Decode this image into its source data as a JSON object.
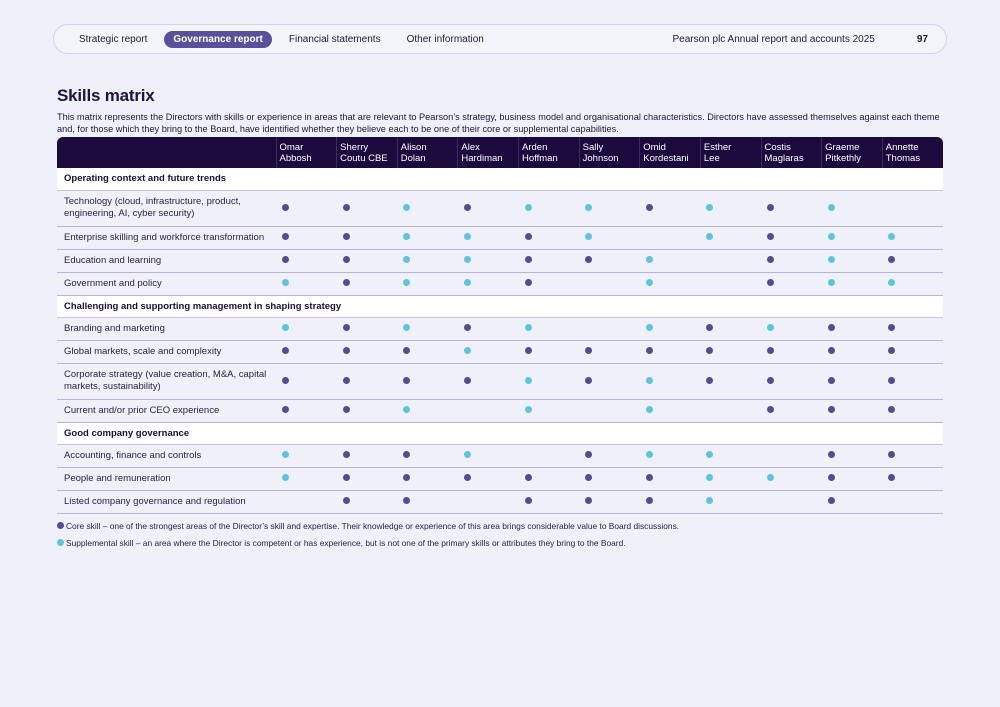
{
  "nav": {
    "links": [
      {
        "label": "Strategic report",
        "active": false
      },
      {
        "label": "Governance report",
        "active": true
      },
      {
        "label": "Financial statements",
        "active": false
      },
      {
        "label": "Other information",
        "active": false
      }
    ],
    "report_title": "Pearson plc Annual report and accounts 2025",
    "page_number": "97"
  },
  "page": {
    "title": "Skills matrix",
    "intro": "This matrix represents the Directors with skills or experience in areas that are relevant to Pearson’s strategy, business model and organisational characteristics. Directors have assessed themselves against each theme and, for those which they bring to the Board, have identified whether they believe each to be one of their core or supplemental capabilities."
  },
  "colors": {
    "core": "#554a93",
    "supplemental": "#5cc4db",
    "header_bg": "#1c0a3e",
    "active_nav": "#5a4f9a"
  },
  "directors": [
    [
      "Omar",
      "Abbosh"
    ],
    [
      "Sherry",
      "Coutu CBE"
    ],
    [
      "Alison",
      "Dolan"
    ],
    [
      "Alex",
      "Hardiman"
    ],
    [
      "Arden",
      "Hoffman"
    ],
    [
      "Sally",
      "Johnson"
    ],
    [
      "Omid",
      "Kordestani"
    ],
    [
      "Esther",
      "Lee"
    ],
    [
      "Costis",
      "Maglaras"
    ],
    [
      "Graeme",
      "Pitkethly"
    ],
    [
      "Annette",
      "Thomas"
    ]
  ],
  "sections": [
    {
      "title": "Operating context and future trends",
      "rows": [
        {
          "label": "Technology (cloud, infrastructure, product, engineering, AI, cyber security)",
          "cells": [
            "c",
            "c",
            "s",
            "c",
            "s",
            "s",
            "c",
            "s",
            "c",
            "s",
            ""
          ]
        },
        {
          "label": "Enterprise skilling and workforce transformation",
          "cells": [
            "c",
            "c",
            "s",
            "s",
            "c",
            "s",
            "",
            "s",
            "c",
            "s",
            "s"
          ]
        },
        {
          "label": "Education and learning",
          "cells": [
            "c",
            "c",
            "s",
            "s",
            "c",
            "c",
            "s",
            "",
            "c",
            "s",
            "c"
          ]
        },
        {
          "label": "Government and policy",
          "cells": [
            "s",
            "c",
            "s",
            "s",
            "c",
            "",
            "s",
            "",
            "c",
            "s",
            "s"
          ]
        }
      ]
    },
    {
      "title": "Challenging and supporting management in shaping strategy",
      "rows": [
        {
          "label": "Branding and marketing",
          "cells": [
            "s",
            "c",
            "s",
            "c",
            "s",
            "",
            "s",
            "c",
            "s",
            "c",
            "c"
          ]
        },
        {
          "label": "Global markets, scale and complexity",
          "cells": [
            "c",
            "c",
            "c",
            "s",
            "c",
            "c",
            "c",
            "c",
            "c",
            "c",
            "c"
          ]
        },
        {
          "label": "Corporate strategy (value creation, M&A, capital markets, sustainability)",
          "cells": [
            "c",
            "c",
            "c",
            "c",
            "s",
            "c",
            "s",
            "c",
            "c",
            "c",
            "c"
          ]
        },
        {
          "label": "Current and/or prior CEO experience",
          "cells": [
            "c",
            "c",
            "s",
            "",
            "s",
            "",
            "s",
            "",
            "c",
            "c",
            "c"
          ]
        }
      ]
    },
    {
      "title": "Good company governance",
      "rows": [
        {
          "label": "Accounting, finance and controls",
          "cells": [
            "s",
            "c",
            "c",
            "s",
            "",
            "c",
            "s",
            "s",
            "",
            "c",
            "c"
          ]
        },
        {
          "label": "People and remuneration",
          "cells": [
            "s",
            "c",
            "c",
            "c",
            "c",
            "c",
            "c",
            "s",
            "s",
            "c",
            "c"
          ]
        },
        {
          "label": "Listed company governance and regulation",
          "cells": [
            "",
            "c",
            "c",
            "",
            "c",
            "c",
            "c",
            "s",
            "",
            "c",
            ""
          ]
        }
      ]
    }
  ],
  "legend": {
    "core": "Core skill – one of the strongest areas of the Director’s skill and expertise. Their knowledge or experience of this area brings considerable value to Board discussions.",
    "supplemental": "Supplemental skill – an area where the Director is competent or has experience, but is not one of the primary skills or attributes they bring to the Board."
  }
}
